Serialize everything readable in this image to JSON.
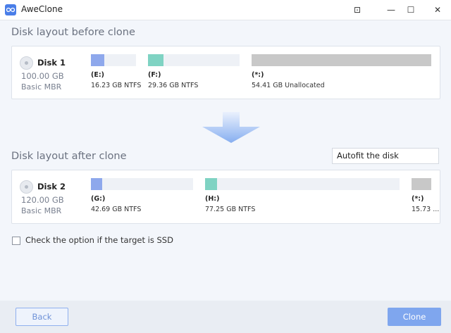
{
  "window": {
    "title": "AweClone",
    "controls": {
      "pin": "⊡",
      "minimize": "—",
      "maximize": "☐",
      "close": "✕"
    }
  },
  "before": {
    "section_title": "Disk layout before clone",
    "disk": {
      "name": "Disk 1",
      "size": "100.00 GB",
      "type": "Basic MBR"
    },
    "partitions": [
      {
        "letter": "(E:)",
        "info": "16.23 GB NTFS",
        "used_fraction": 0.3,
        "color": "#8ea8ec"
      },
      {
        "letter": "(F:)",
        "info": "29.36 GB NTFS",
        "used_fraction": 0.17,
        "color": "#7fd3c3"
      },
      {
        "letter": "(*:)",
        "info": "54.41 GB Unallocated",
        "used_fraction": 1.0,
        "color": "#c8c8c8"
      }
    ]
  },
  "after": {
    "section_title": "Disk layout after clone",
    "autofit_option": "Autofit the disk",
    "disk": {
      "name": "Disk 2",
      "size": "120.00 GB",
      "type": "Basic MBR"
    },
    "partitions": [
      {
        "letter": "(G:)",
        "info": "42.69 GB NTFS",
        "used_fraction": 0.11,
        "color": "#8ea8ec"
      },
      {
        "letter": "(H:)",
        "info": "77.25 GB NTFS",
        "used_fraction": 0.06,
        "color": "#7fd3c3"
      },
      {
        "letter": "(*:)",
        "info": "15.73 ...",
        "used_fraction": 1.0,
        "color": "#c8c8c8"
      }
    ]
  },
  "ssd_option": {
    "label": "Check the option if the target is SSD",
    "checked": false
  },
  "footer": {
    "back_label": "Back",
    "clone_label": "Clone"
  },
  "colors": {
    "accent": "#7fa6ee",
    "arrow": "#8fb3f0"
  }
}
